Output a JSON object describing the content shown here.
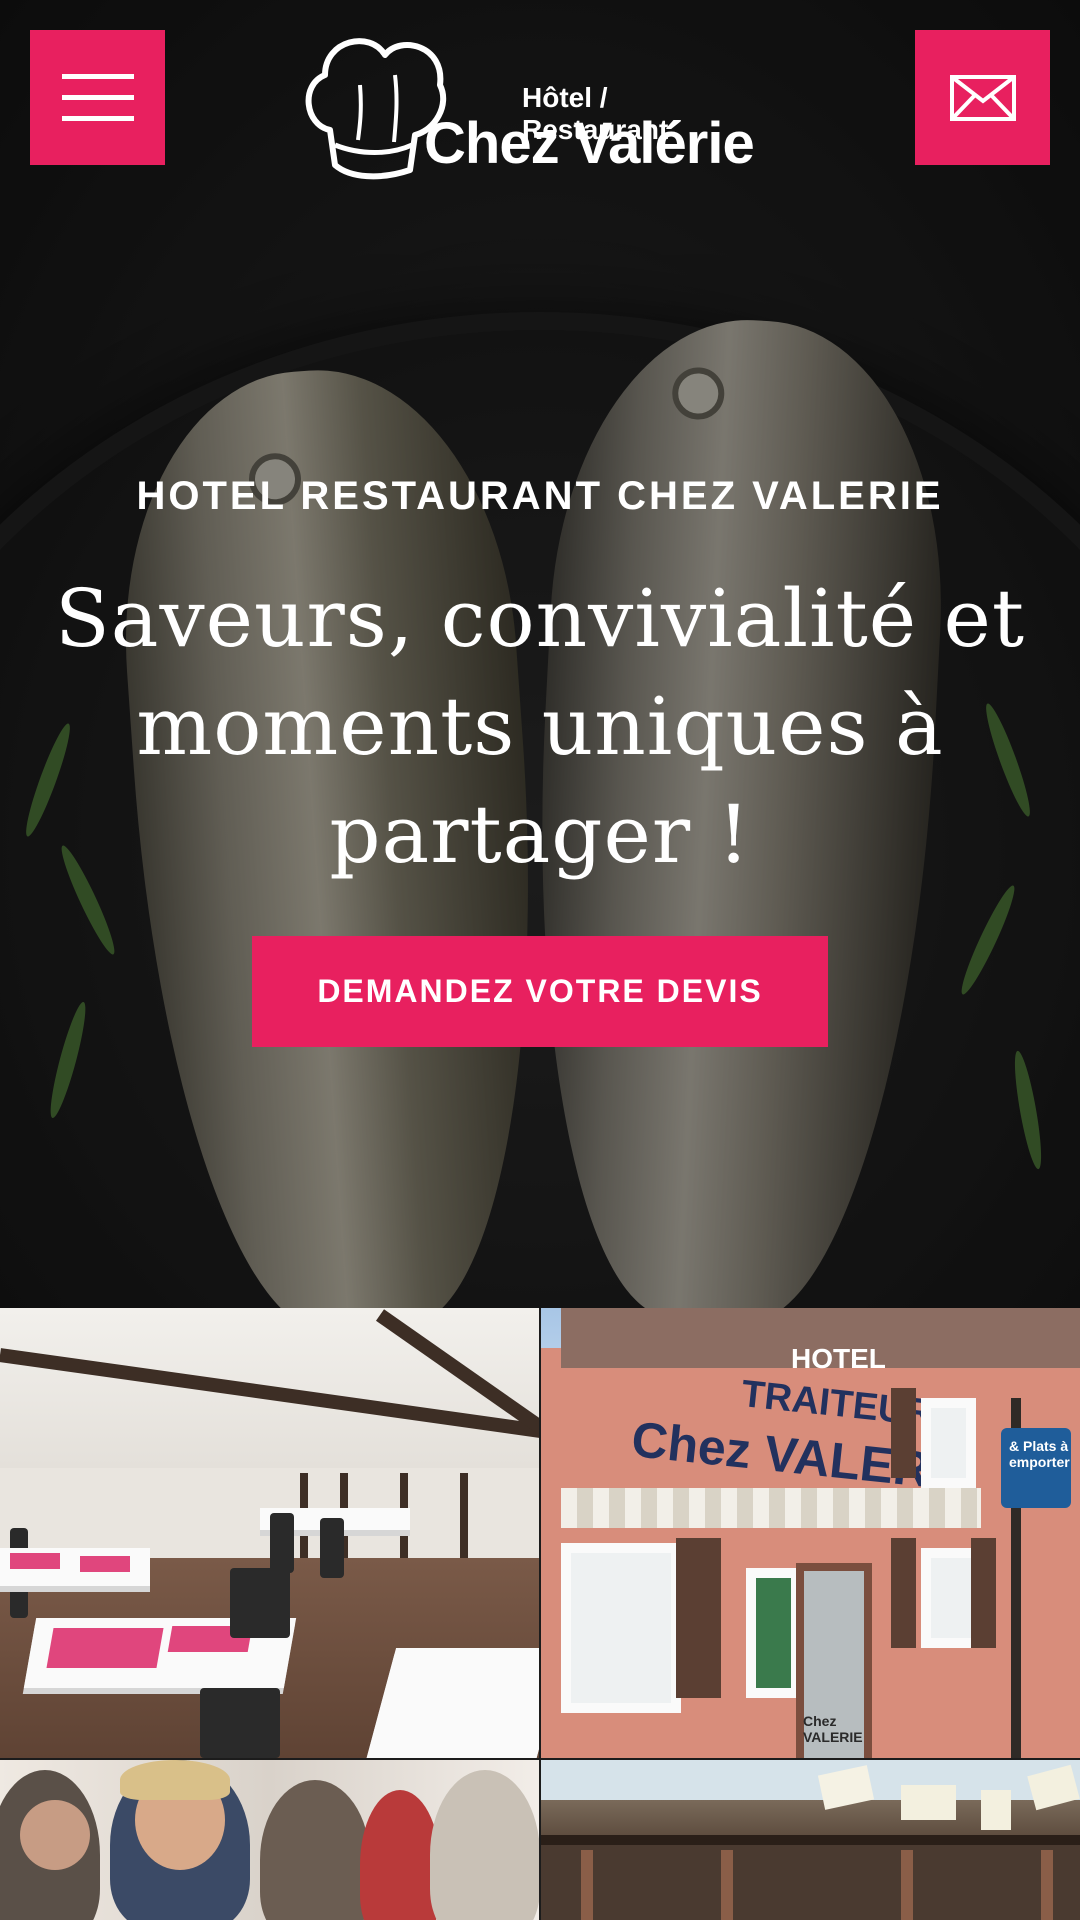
{
  "header": {
    "logo": {
      "line1": "Hôtel / Restaurant",
      "line2": "Chez Valérie"
    }
  },
  "hero": {
    "kicker": "HOTEL RESTAURANT CHEZ VALERIE",
    "headline": "Saveurs, convivialité et moments uniques à partager !",
    "cta_label": "DEMANDEZ VOTRE DEVIS"
  },
  "gallery": {
    "facade_sign_top": "HOTEL",
    "facade_sign_mid": "TRAITEUR",
    "facade_sign_main": "Chez VALERIE",
    "facade_blue_sign": "& Plats à emporter",
    "door_text": "Chez VALERIE"
  },
  "colors": {
    "accent": "#e8205f"
  }
}
